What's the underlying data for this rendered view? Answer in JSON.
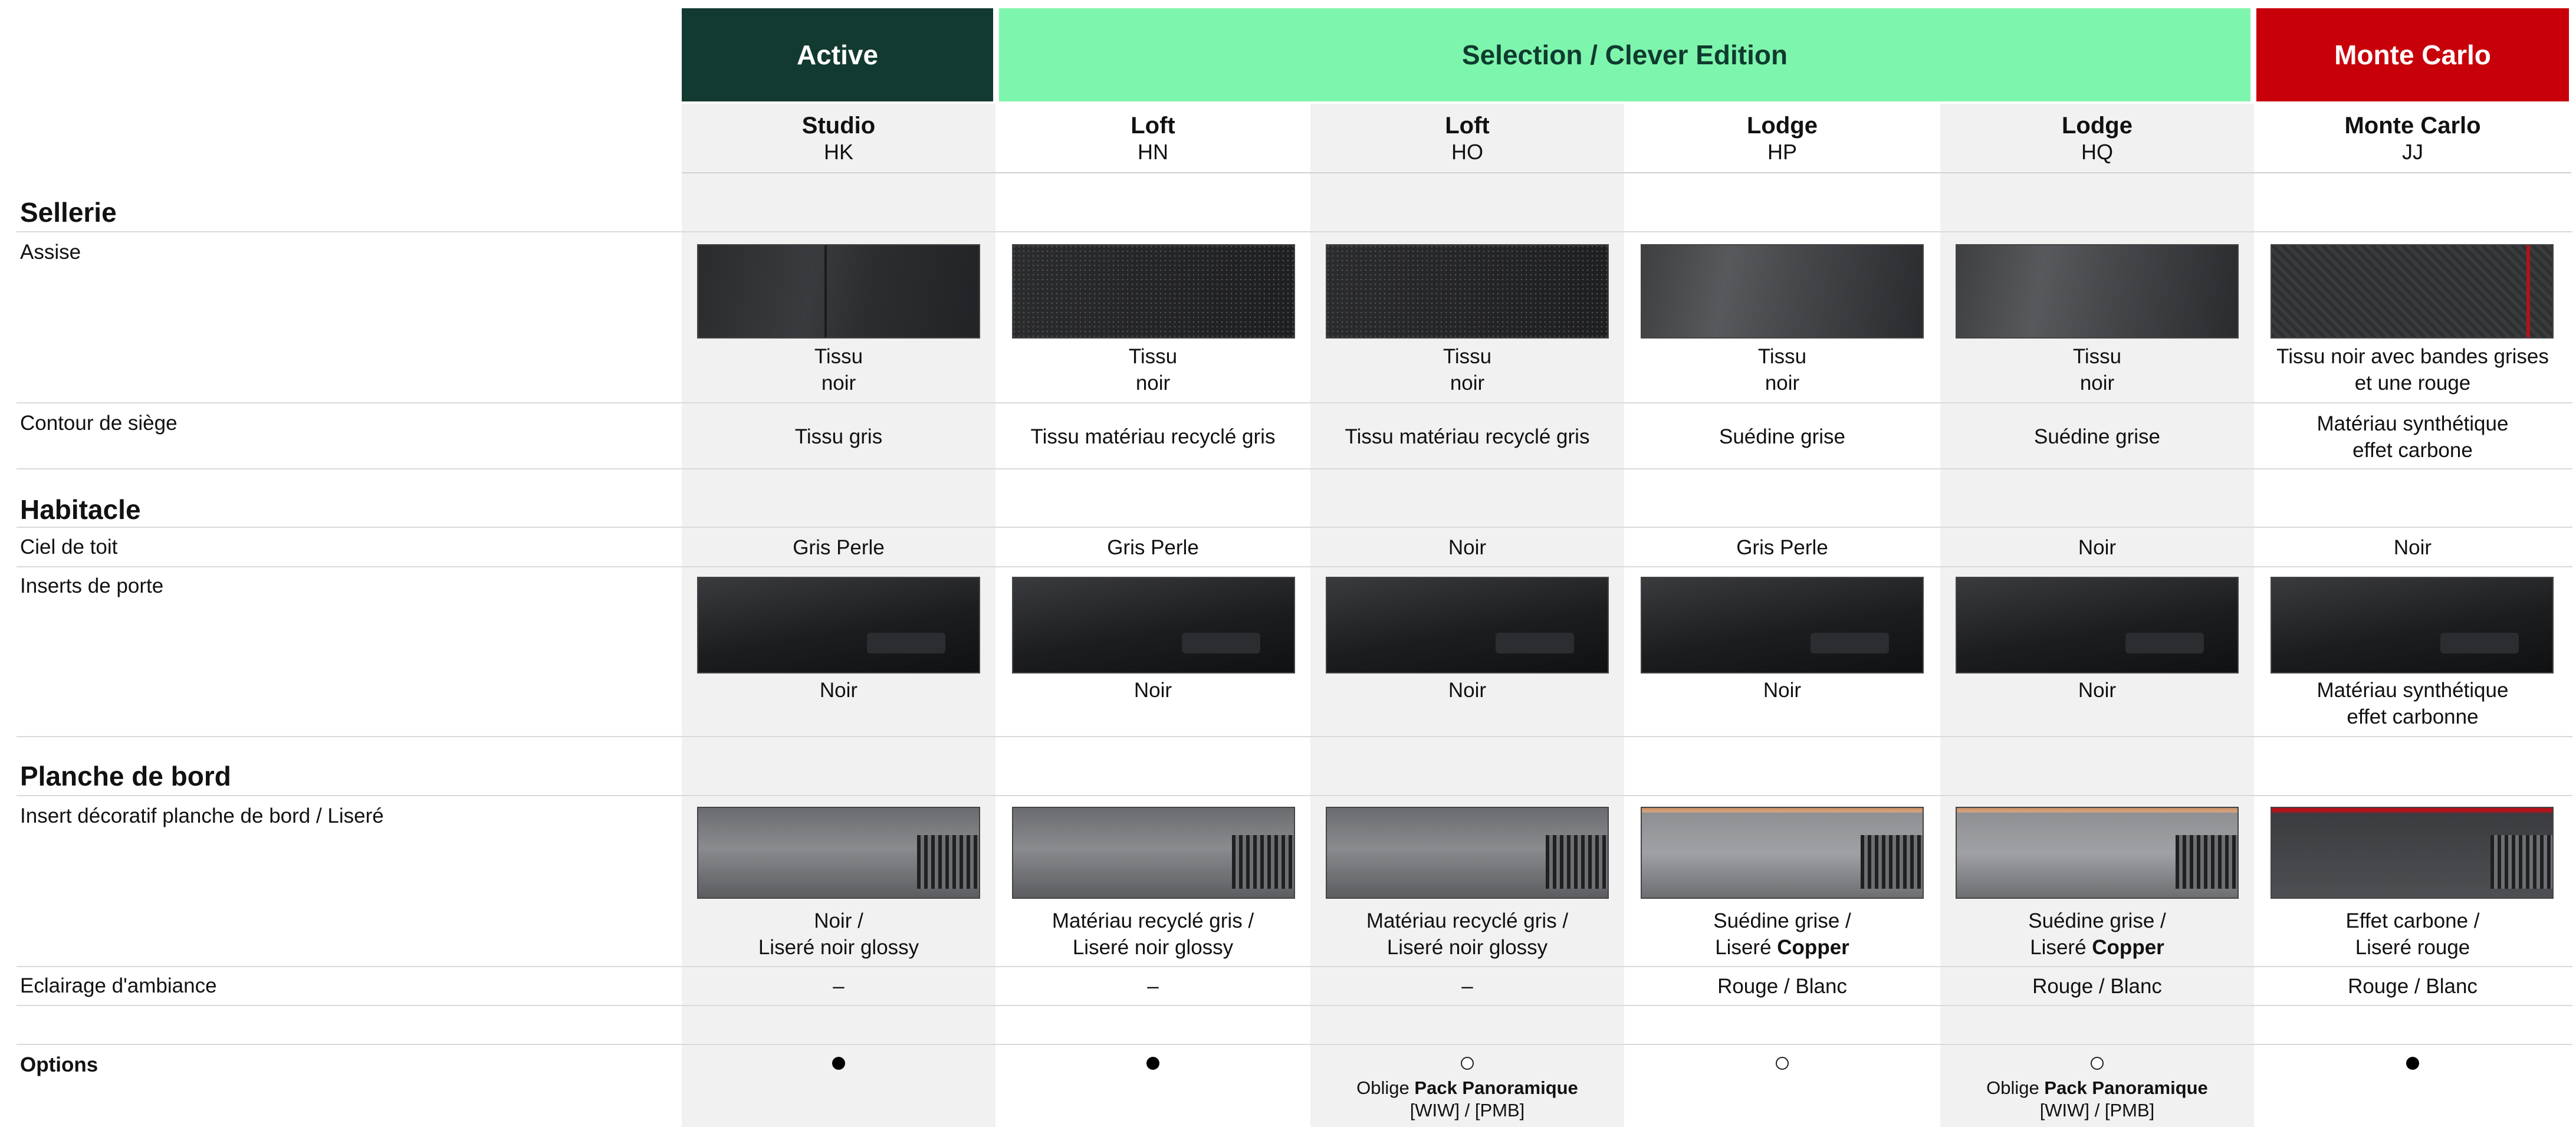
{
  "groups": {
    "active": "Active",
    "selection": "Selection / Clever Edition",
    "monte_carlo": "Monte Carlo"
  },
  "trims": [
    {
      "name": "Studio",
      "code": "HK"
    },
    {
      "name": "Loft",
      "code": "HN"
    },
    {
      "name": "Loft",
      "code": "HO"
    },
    {
      "name": "Lodge",
      "code": "HP"
    },
    {
      "name": "Lodge",
      "code": "HQ"
    },
    {
      "name": "Monte Carlo",
      "code": "JJ"
    }
  ],
  "sections": {
    "sellerie": "Sellerie",
    "habitacle": "Habitacle",
    "planche": "Planche de bord"
  },
  "labels": {
    "assise": "Assise",
    "contour": "Contour de siège",
    "ciel": "Ciel de toit",
    "inserts_porte": "Inserts de porte",
    "insert_deco": "Insert décoratif planche de bord / Liseré",
    "eclairage": "Eclairage d'ambiance",
    "options": "Options"
  },
  "assise": [
    [
      "Tissu",
      "noir"
    ],
    [
      "Tissu",
      "noir"
    ],
    [
      "Tissu",
      "noir"
    ],
    [
      "Tissu",
      "noir"
    ],
    [
      "Tissu",
      "noir"
    ],
    [
      "Tissu noir avec bandes grises",
      "et une rouge"
    ]
  ],
  "contour": [
    [
      "Tissu gris"
    ],
    [
      "Tissu matériau recyclé gris"
    ],
    [
      "Tissu matériau recyclé gris"
    ],
    [
      "Suédine grise"
    ],
    [
      "Suédine grise"
    ],
    [
      "Matériau synthétique",
      "effet carbone"
    ]
  ],
  "ciel": [
    "Gris Perle",
    "Gris Perle",
    "Noir",
    "Gris Perle",
    "Noir",
    "Noir"
  ],
  "inserts_porte": [
    [
      "Noir"
    ],
    [
      "Noir"
    ],
    [
      "Noir"
    ],
    [
      "Noir"
    ],
    [
      "Noir"
    ],
    [
      "Matériau synthétique",
      "effet carbonne"
    ]
  ],
  "insert_deco": [
    {
      "l1": "Noir /",
      "l2a": "Liseré noir glossy",
      "l2b": ""
    },
    {
      "l1": "Matériau recyclé gris /",
      "l2a": "Liseré noir glossy",
      "l2b": ""
    },
    {
      "l1": "Matériau recyclé gris /",
      "l2a": "Liseré noir glossy",
      "l2b": ""
    },
    {
      "l1": "Suédine grise /",
      "l2a": "Liseré ",
      "l2b": "Copper"
    },
    {
      "l1": "Suédine grise /",
      "l2a": "Liseré ",
      "l2b": "Copper"
    },
    {
      "l1": "Effet carbone /",
      "l2a": "Liseré rouge",
      "l2b": ""
    }
  ],
  "eclairage": [
    "–",
    "–",
    "–",
    "Rouge / Blanc",
    "Rouge / Blanc",
    "Rouge / Blanc"
  ],
  "options": [
    {
      "status": "standard",
      "note_prefix": "",
      "note_bold": "",
      "note_codes": ""
    },
    {
      "status": "standard",
      "note_prefix": "",
      "note_bold": "",
      "note_codes": ""
    },
    {
      "status": "optional",
      "note_prefix": "Oblige ",
      "note_bold": "Pack Panoramique",
      "note_codes": "[WIW] / [PMB]"
    },
    {
      "status": "optional",
      "note_prefix": "",
      "note_bold": "",
      "note_codes": ""
    },
    {
      "status": "optional",
      "note_prefix": "Oblige ",
      "note_bold": "Pack Panoramique",
      "note_codes": "[WIW] / [PMB]"
    },
    {
      "status": "standard",
      "note_prefix": "",
      "note_bold": "",
      "note_codes": ""
    }
  ],
  "swatches": {
    "assise": [
      "seat-dark",
      "seat-perf",
      "seat-perf",
      "seat-suede",
      "seat-suede",
      "seat-carbon"
    ],
    "porte": [
      "door-dark",
      "door-dark",
      "door-dark",
      "door-dark",
      "door-dark",
      "door-dark"
    ],
    "deco": [
      "dash-grey",
      "dash-grey",
      "dash-grey",
      "dash-copper",
      "dash-copper",
      "dash-red"
    ]
  },
  "colors": {
    "active": "#133a31",
    "selection": "#7ef5ad",
    "monte_carlo": "#c8000a",
    "stripe": "#f0f1f0"
  }
}
